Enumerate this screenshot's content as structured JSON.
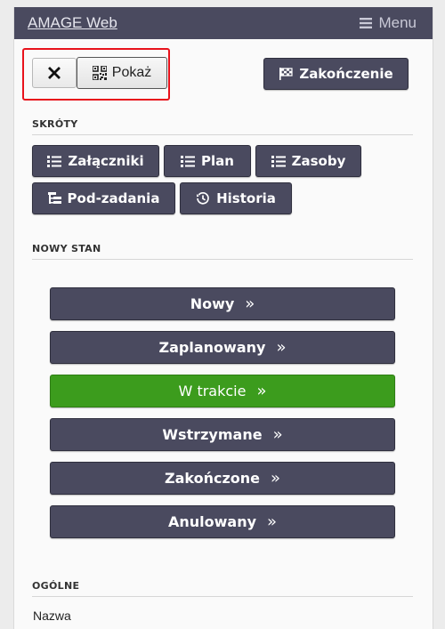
{
  "topbar": {
    "brand": "AMAGE Web",
    "menu_label": "Menu"
  },
  "toolbar": {
    "close_label": "✕",
    "show_label": "Pokaż",
    "finish_label": "Zakończenie"
  },
  "shortcuts": {
    "title": "SKRÓTY",
    "items": [
      {
        "label": "Załączniki",
        "icon": "list-icon"
      },
      {
        "label": "Plan",
        "icon": "list-icon"
      },
      {
        "label": "Zasoby",
        "icon": "list-icon"
      },
      {
        "label": "Pod-zadania",
        "icon": "tree-icon"
      },
      {
        "label": "Historia",
        "icon": "history-icon"
      }
    ]
  },
  "new_state": {
    "title": "NOWY STAN",
    "states": [
      {
        "label": "Nowy",
        "active": false
      },
      {
        "label": "Zaplanowany",
        "active": false
      },
      {
        "label": "W trakcie",
        "active": true
      },
      {
        "label": "Wstrzymane",
        "active": false
      },
      {
        "label": "Zakończone",
        "active": false
      },
      {
        "label": "Anulowany",
        "active": false
      }
    ],
    "chevron": "»"
  },
  "general": {
    "title": "OGÓLNE",
    "name_label": "Nazwa"
  },
  "colors": {
    "primary": "#4a4a5f",
    "active_state": "#3c9c1d",
    "highlight": "#e8121b"
  }
}
